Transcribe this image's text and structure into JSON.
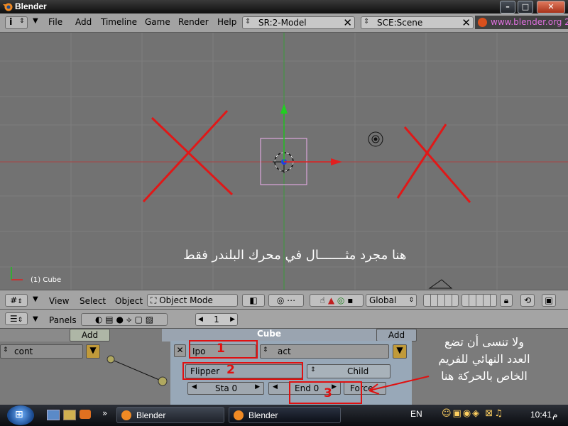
{
  "window": {
    "title": "Blender"
  },
  "top_header": {
    "menus": [
      "File",
      "Add",
      "Timeline",
      "Game",
      "Render",
      "Help"
    ],
    "screen": "SR:2-Model",
    "scene": "SCE:Scene",
    "url": "www.blender.org 2"
  },
  "viewport": {
    "object_label": "(1) Cube",
    "note": "هنا مجرد مثـــــــال في محرك البلندر فقط"
  },
  "viewport_header": {
    "menus": [
      "View",
      "Select",
      "Object"
    ],
    "mode": "Object Mode",
    "orientation": "Global"
  },
  "buttons_header": {
    "panels_label": "Panels",
    "frame": "1"
  },
  "logic": {
    "sensor_add": "Add",
    "controller_add": "Add",
    "object_name": "Cube",
    "sensor_name": "cont",
    "actuator_type": "Ipo",
    "actuator_name": "act",
    "ipo_mode": "Flipper",
    "child_label": "Child",
    "start": "Sta 0",
    "end": "End 0",
    "force": "Force",
    "markers": [
      "1",
      "2",
      "3"
    ],
    "note_lines": [
      "ولا تنسى أن تضع",
      "العدد النهائي للفريم",
      "الخاص بالحركة هنا"
    ]
  },
  "taskbar": {
    "tasks": [
      "Blender",
      "Blender"
    ],
    "lang": "EN",
    "time": "10:41",
    "ampm": "م"
  },
  "colors": {
    "highlight": "#e01010",
    "viewport_bg": "#727272"
  }
}
